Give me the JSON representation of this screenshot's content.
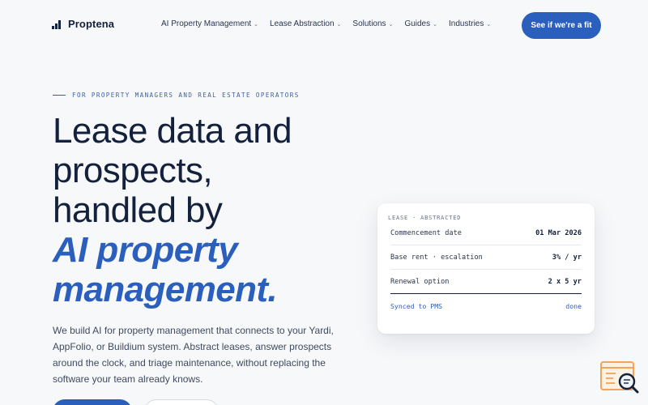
{
  "brand": {
    "name": "Proptena"
  },
  "nav": {
    "items": [
      {
        "label": "AI Property Management"
      },
      {
        "label": "Lease Abstraction"
      },
      {
        "label": "Solutions"
      },
      {
        "label": "Guides"
      },
      {
        "label": "Industries"
      }
    ],
    "cta_label": "See if we're a fit"
  },
  "hero": {
    "eyebrow": "FOR PROPERTY MANAGERS AND REAL ESTATE OPERATORS",
    "headline_lines": [
      "Lease data and",
      "prospects,",
      "handled by"
    ],
    "headline_accent_lines": [
      "AI property",
      "management."
    ],
    "description": "We build AI for property management that connects to your Yardi, AppFolio, or Buildium system. Abstract leases, answer prospects around the clock, and triage maintenance, without replacing the software your team already knows."
  },
  "card": {
    "label": "LEASE · ABSTRACTED",
    "rows": [
      {
        "key": "Commencement date",
        "value": "01 Mar 2026"
      },
      {
        "key": "Base rent · escalation",
        "value": "3% / yr"
      },
      {
        "key": "Renewal option",
        "value": "2 x 5 yr"
      }
    ],
    "footer_left": "Synced to PMS",
    "footer_right": "done"
  },
  "colors": {
    "accent": "#2b5fbd",
    "ink": "#14213d",
    "background": "#f7f8fa",
    "widget": "#f0a45c"
  }
}
